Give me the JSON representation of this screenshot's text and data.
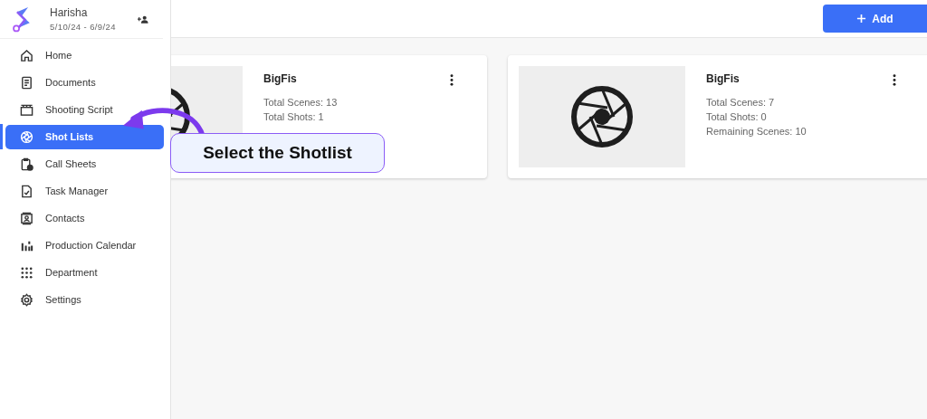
{
  "sidebar": {
    "user": {
      "name": "Harisha",
      "dates": "5/10/24 - 6/9/24"
    },
    "items": [
      {
        "label": "Home",
        "selected": false
      },
      {
        "label": "Documents",
        "selected": false
      },
      {
        "label": "Shooting Script",
        "selected": false
      },
      {
        "label": "Shot Lists",
        "selected": true
      },
      {
        "label": "Call Sheets",
        "selected": false
      },
      {
        "label": "Task Manager",
        "selected": false
      },
      {
        "label": "Contacts",
        "selected": false
      },
      {
        "label": "Production Calendar",
        "selected": false
      },
      {
        "label": "Department",
        "selected": false
      },
      {
        "label": "Settings",
        "selected": false
      }
    ]
  },
  "toolbar": {
    "add_button": "Add"
  },
  "cards": [
    {
      "title": "BigFis",
      "stats": [
        "Total Scenes: 13",
        "Total Shots: 1"
      ]
    },
    {
      "title": "BigFis",
      "stats": [
        "Total Scenes: 7",
        "Total Shots: 0",
        "Remaining Scenes: 10"
      ]
    }
  ],
  "callout": {
    "text": "Select the Shotlist"
  }
}
